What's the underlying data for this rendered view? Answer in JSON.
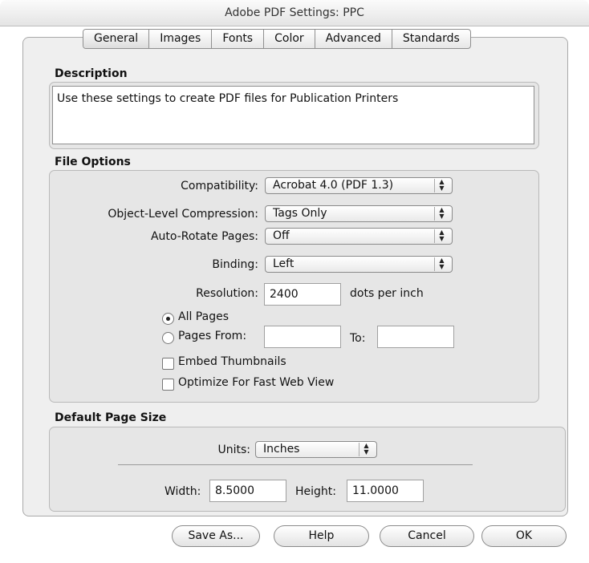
{
  "window": {
    "title": "Adobe PDF Settings: PPC"
  },
  "tabs": [
    {
      "label": "General",
      "selected": true
    },
    {
      "label": "Images"
    },
    {
      "label": "Fonts"
    },
    {
      "label": "Color"
    },
    {
      "label": "Advanced"
    },
    {
      "label": "Standards"
    }
  ],
  "description": {
    "label": "Description",
    "text": "Use these settings to create PDF files for Publication Printers"
  },
  "file_options": {
    "label": "File Options",
    "compatibility": {
      "label": "Compatibility:",
      "value": "Acrobat 4.0 (PDF 1.3)"
    },
    "compression": {
      "label": "Object-Level Compression:",
      "value": "Tags Only"
    },
    "auto_rotate": {
      "label": "Auto-Rotate Pages:",
      "value": "Off"
    },
    "binding": {
      "label": "Binding:",
      "value": "Left"
    },
    "resolution": {
      "label": "Resolution:",
      "value": "2400",
      "unit": "dots per inch"
    },
    "all_pages": {
      "label": "All Pages",
      "selected": true
    },
    "pages_from": {
      "label": "Pages From:",
      "from_value": "",
      "to_label": "To:",
      "to_value": ""
    },
    "embed_thumbnails": {
      "label": "Embed Thumbnails",
      "checked": false
    },
    "optimize_web": {
      "label": "Optimize For Fast Web View",
      "checked": false
    }
  },
  "page_size": {
    "label": "Default Page Size",
    "units": {
      "label": "Units:",
      "value": "Inches"
    },
    "width": {
      "label": "Width:",
      "value": "8.5000"
    },
    "height": {
      "label": "Height:",
      "value": "11.0000"
    }
  },
  "buttons": {
    "save_as": "Save As...",
    "help": "Help",
    "cancel": "Cancel",
    "ok": "OK"
  },
  "icons": {
    "popup_arrows": "up-down-arrows-icon"
  }
}
